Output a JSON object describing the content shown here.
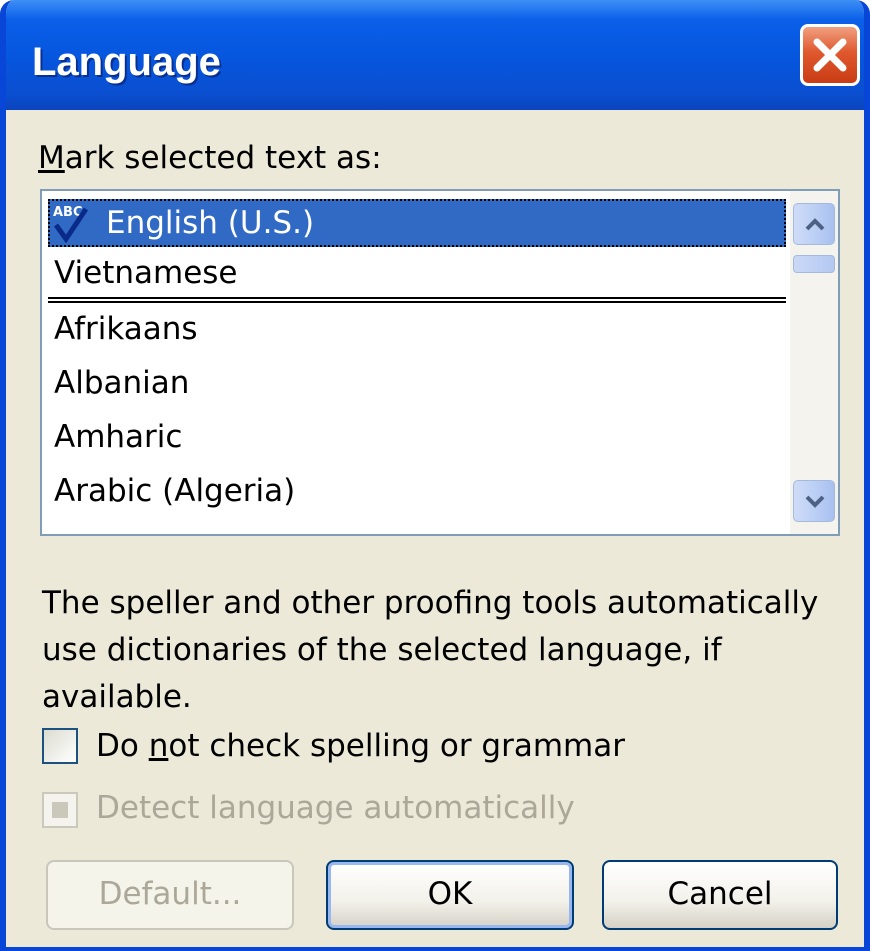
{
  "window": {
    "title": "Language"
  },
  "dialog": {
    "mark_label_prefix": "",
    "mark_label_accel": "M",
    "mark_label_rest": "ark selected text as:",
    "language_list": {
      "selected": "English (U.S.)",
      "recent": [
        "English (U.S.)",
        "Vietnamese"
      ],
      "all": [
        "Afrikaans",
        "Albanian",
        "Amharic",
        "Arabic (Algeria)"
      ]
    },
    "description": "The speller and other proofing tools automatically use dictionaries of the selected language, if available.",
    "no_check": {
      "prefix": "Do ",
      "accel": "n",
      "rest": "ot check spelling or grammar",
      "checked": false
    },
    "detect": {
      "label": "Detect language automatically",
      "enabled": false
    }
  },
  "buttons": {
    "default": "Default...",
    "ok": "OK",
    "cancel": "Cancel"
  },
  "icons": {
    "close": "close-icon",
    "abc_check": "spelling-check-icon",
    "scroll_up": "chevron-up-icon",
    "scroll_down": "chevron-down-icon"
  },
  "colors": {
    "title_blue": "#0655dd",
    "selection": "#316ac5",
    "face": "#ece9d8",
    "close_red": "#e0582e"
  }
}
